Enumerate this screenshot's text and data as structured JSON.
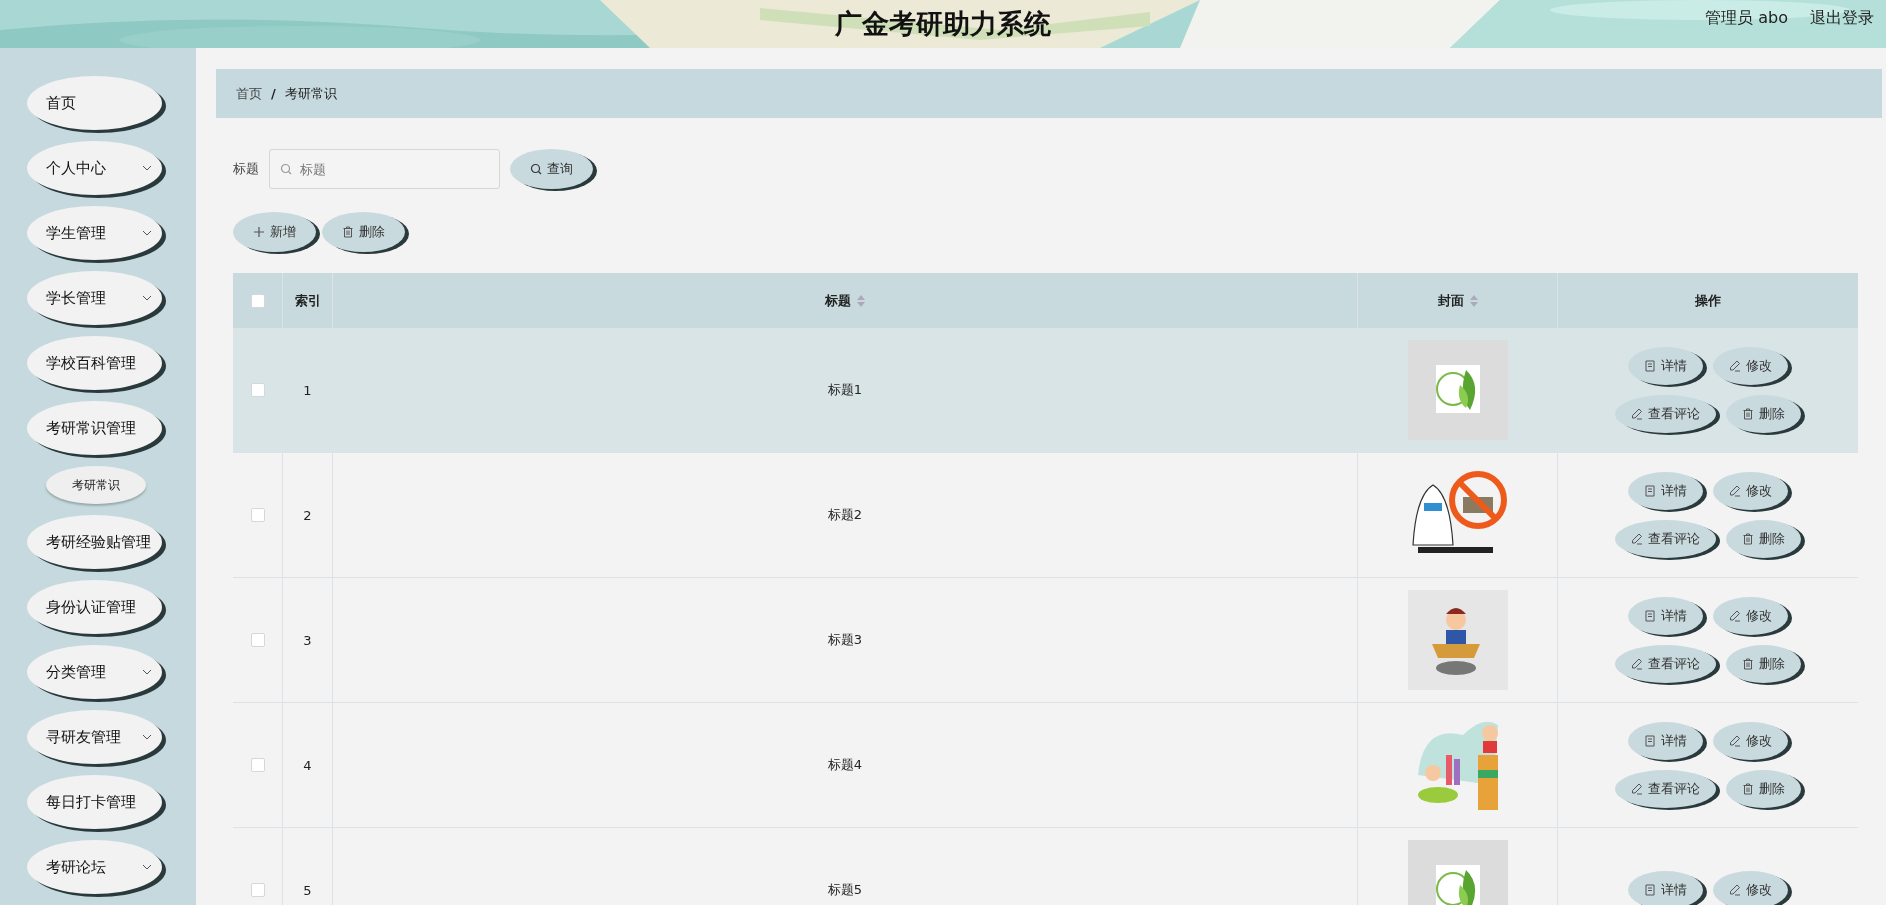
{
  "header": {
    "title": "广金考研助力系统",
    "user": "管理员 abo",
    "logout": "退出登录"
  },
  "sidebar": {
    "items": [
      {
        "label": "首页",
        "has_submenu": false
      },
      {
        "label": "个人中心",
        "has_submenu": true
      },
      {
        "label": "学生管理",
        "has_submenu": true
      },
      {
        "label": "学长管理",
        "has_submenu": true
      },
      {
        "label": "学校百科管理",
        "has_submenu": false
      },
      {
        "label": "考研常识管理",
        "has_submenu": false,
        "children": [
          {
            "label": "考研常识"
          }
        ]
      },
      {
        "label": "考研经验贴管理",
        "has_submenu": false
      },
      {
        "label": "身份认证管理",
        "has_submenu": false
      },
      {
        "label": "分类管理",
        "has_submenu": true
      },
      {
        "label": "寻研友管理",
        "has_submenu": true
      },
      {
        "label": "每日打卡管理",
        "has_submenu": false
      },
      {
        "label": "考研论坛",
        "has_submenu": true
      }
    ]
  },
  "breadcrumb": {
    "separator": "/",
    "items": [
      "首页",
      "考研常识"
    ]
  },
  "search": {
    "label": "标题",
    "placeholder": "标题",
    "button": "查询"
  },
  "toolbar": [
    {
      "kind": "add",
      "label": "新增"
    },
    {
      "kind": "delete",
      "label": "删除"
    }
  ],
  "table": {
    "select_all": false,
    "columns": [
      {
        "label": "索引",
        "sortable": false
      },
      {
        "label": "标题",
        "sortable": true
      },
      {
        "label": "封面",
        "sortable": true
      },
      {
        "label": "操作",
        "sortable": false
      }
    ],
    "rows": [
      {
        "index": "1",
        "title": "标题1",
        "checked": false,
        "highlighted": true,
        "actions": [
          {
            "kind": "detail",
            "label": "详情"
          },
          {
            "kind": "edit",
            "label": "修改"
          },
          {
            "kind": "comment",
            "label": "查看评论"
          },
          {
            "kind": "delete",
            "label": "删除"
          }
        ]
      },
      {
        "index": "2",
        "title": "标题2",
        "checked": false,
        "highlighted": false,
        "actions": [
          {
            "kind": "detail",
            "label": "详情"
          },
          {
            "kind": "edit",
            "label": "修改"
          },
          {
            "kind": "comment",
            "label": "查看评论"
          },
          {
            "kind": "delete",
            "label": "删除"
          }
        ]
      },
      {
        "index": "3",
        "title": "标题3",
        "checked": false,
        "highlighted": false,
        "actions": [
          {
            "kind": "detail",
            "label": "详情"
          },
          {
            "kind": "edit",
            "label": "修改"
          },
          {
            "kind": "comment",
            "label": "查看评论"
          },
          {
            "kind": "delete",
            "label": "删除"
          }
        ]
      },
      {
        "index": "4",
        "title": "标题4",
        "checked": false,
        "highlighted": false,
        "actions": [
          {
            "kind": "detail",
            "label": "详情"
          },
          {
            "kind": "edit",
            "label": "修改"
          },
          {
            "kind": "comment",
            "label": "查看评论"
          },
          {
            "kind": "delete",
            "label": "删除"
          }
        ]
      },
      {
        "index": "5",
        "title": "标题5",
        "checked": false,
        "highlighted": false,
        "actions": [
          {
            "kind": "detail",
            "label": "详情"
          },
          {
            "kind": "edit",
            "label": "修改"
          }
        ]
      }
    ]
  }
}
